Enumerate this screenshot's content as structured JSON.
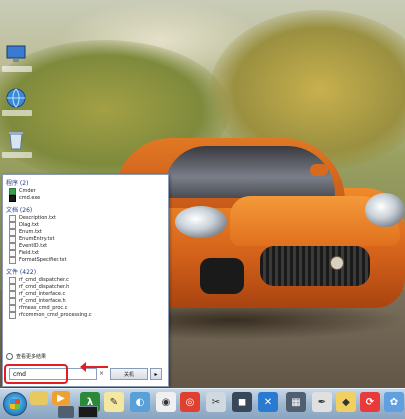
{
  "desktop": {
    "icons": [
      {
        "name": "computer-icon"
      },
      {
        "name": "network-icon"
      },
      {
        "name": "recycle-bin-icon"
      }
    ]
  },
  "start_menu": {
    "groups": [
      {
        "header": "程序 (2)",
        "items": [
          {
            "label": "Cmder",
            "icon": "green"
          },
          {
            "label": "cmd.exe",
            "icon": "black"
          }
        ]
      },
      {
        "header": "文档 (26)",
        "items": [
          {
            "label": "Description.txt"
          },
          {
            "label": "Dlag.txt"
          },
          {
            "label": "Enum.txt"
          },
          {
            "label": "EnumEntry.txt"
          },
          {
            "label": "EventID.txt"
          },
          {
            "label": "Field.txt"
          },
          {
            "label": "FormatSpecifier.txt"
          }
        ]
      },
      {
        "header": "文件 (422)",
        "items": [
          {
            "label": "rf_cmd_dispatcher.c"
          },
          {
            "label": "rf_cmd_dispatcher.h"
          },
          {
            "label": "rf_cmd_interface.c"
          },
          {
            "label": "rf_cmd_interface.h"
          },
          {
            "label": "rfmeas_cmd_proc.c"
          },
          {
            "label": "rfcommon_cmd_processing.c"
          }
        ]
      }
    ],
    "more_results": "查看更多结果",
    "search": {
      "value": "cmd",
      "clear_glyph": "×"
    },
    "shutdown_label": "关机",
    "shutdown_arrow": "▸"
  },
  "taskbar": {
    "pinned": [
      {
        "name": "folder-icon",
        "glyph": "",
        "bg": "#e8c860"
      },
      {
        "name": "media-player-icon",
        "glyph": "▶",
        "bg": "#f0a030"
      },
      {
        "name": "lambda-icon",
        "glyph": "λ",
        "bg": "#2a8a3a"
      },
      {
        "name": "note-icon",
        "glyph": "✎",
        "bg": "#f4e8a0"
      },
      {
        "name": "app-icon",
        "glyph": "◐",
        "bg": "#5aa0d8"
      },
      {
        "name": "browser-icon",
        "glyph": "◉",
        "bg": "#f0f0f0"
      },
      {
        "name": "chrome-icon",
        "glyph": "◎",
        "bg": "#e04030"
      },
      {
        "name": "tools-icon",
        "glyph": "✂",
        "bg": "#d0d8e0"
      },
      {
        "name": "media-icon",
        "glyph": "◼",
        "bg": "#384858"
      },
      {
        "name": "close-circle-icon",
        "glyph": "✕",
        "bg": "#2a7ad0"
      },
      {
        "name": "calculator-icon",
        "glyph": "▦",
        "bg": "#506070"
      },
      {
        "name": "editor-icon",
        "glyph": "✒",
        "bg": "#e0e0e0"
      },
      {
        "name": "paint-icon",
        "glyph": "◆",
        "bg": "#f0d060"
      },
      {
        "name": "app-red-icon",
        "glyph": "⟳",
        "bg": "#e83a3a"
      },
      {
        "name": "app-blue-icon",
        "glyph": "✿",
        "bg": "#60a0e0"
      }
    ]
  },
  "colors": {
    "annotation": "#e02020",
    "menu_header": "#1e3a8a"
  }
}
